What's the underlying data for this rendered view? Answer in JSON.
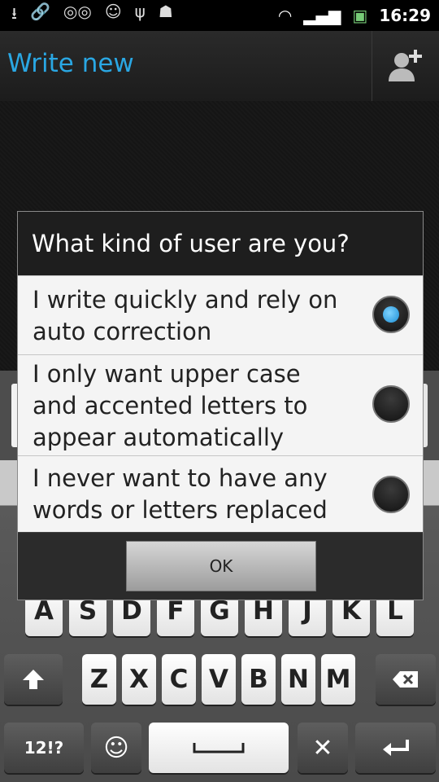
{
  "status": {
    "time": "16:29"
  },
  "header": {
    "title": "Write new"
  },
  "dialog": {
    "title": "What kind of user are you?",
    "options": [
      {
        "label": "I write quickly and rely on auto correction",
        "selected": true
      },
      {
        "label": "I only want upper case and accented letters to appear automatically",
        "selected": false
      },
      {
        "label": "I never want to have any words or letters replaced",
        "selected": false
      }
    ],
    "ok_label": "OK"
  },
  "keyboard": {
    "row_asdf": [
      "A",
      "S",
      "D",
      "F",
      "G",
      "H",
      "J",
      "K",
      "L"
    ],
    "row_zxcv": [
      "Z",
      "X",
      "C",
      "V",
      "B",
      "N",
      "M"
    ],
    "symbols_label": "12!?"
  }
}
